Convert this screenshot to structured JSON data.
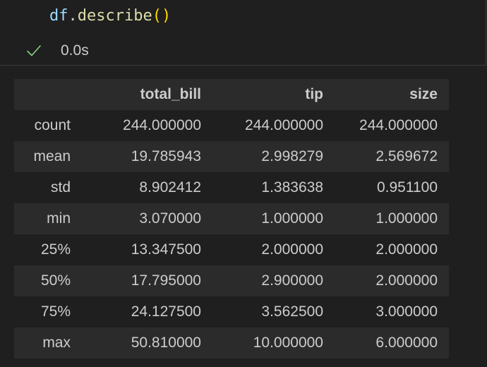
{
  "cell": {
    "code": {
      "var": "df",
      "dot": ".",
      "func": "describe",
      "parens": "()"
    },
    "status_icon": "check-icon",
    "exec_time": "0.0s"
  },
  "table": {
    "columns": [
      "",
      "total_bill",
      "tip",
      "size"
    ],
    "rows": [
      {
        "label": "count",
        "values": [
          "244.000000",
          "244.000000",
          "244.000000"
        ]
      },
      {
        "label": "mean",
        "values": [
          "19.785943",
          "2.998279",
          "2.569672"
        ]
      },
      {
        "label": "std",
        "values": [
          "8.902412",
          "1.383638",
          "0.951100"
        ]
      },
      {
        "label": "min",
        "values": [
          "3.070000",
          "1.000000",
          "1.000000"
        ]
      },
      {
        "label": "25%",
        "values": [
          "13.347500",
          "2.000000",
          "2.000000"
        ]
      },
      {
        "label": "50%",
        "values": [
          "17.795000",
          "2.900000",
          "2.000000"
        ]
      },
      {
        "label": "75%",
        "values": [
          "24.127500",
          "3.562500",
          "3.000000"
        ]
      },
      {
        "label": "max",
        "values": [
          "50.810000",
          "10.000000",
          "6.000000"
        ]
      }
    ]
  },
  "colors": {
    "background": "#1f1f1f",
    "stripe": "#2b2b2b",
    "success": "#89d185",
    "variable": "#9cdcfe",
    "function": "#dcdcaa",
    "bracket": "#ffd700"
  }
}
